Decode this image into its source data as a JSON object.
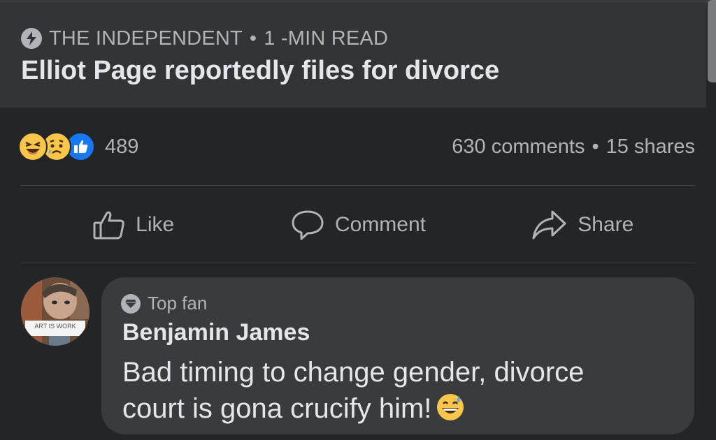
{
  "article": {
    "source": "THE INDEPENDENT",
    "separator": "•",
    "read_time": "1 -MIN READ",
    "title": "Elliot Page reportedly files for divorce"
  },
  "reactions": {
    "icons": [
      "laughing-reaction-icon",
      "sad-reaction-icon",
      "like-reaction-icon"
    ],
    "count": "489"
  },
  "stats": {
    "comments": "630 comments",
    "separator": "•",
    "shares": "15 shares"
  },
  "actions": {
    "like": "Like",
    "comment": "Comment",
    "share": "Share"
  },
  "comment": {
    "badge": "Top fan",
    "author": "Benjamin James",
    "text": "Bad timing to change gender, divorce court is gona crucify him!",
    "emoji": "grinning-sweat-emoji",
    "avatar_caption": "ART IS WORK"
  },
  "colors": {
    "background": "#242526",
    "card": "#323436",
    "bubble": "#3a3b3c",
    "primary_text": "#e4e6eb",
    "secondary_text": "#b0b3b8",
    "like_blue": "#1877f2",
    "reaction_yellow": "#f7c64a"
  }
}
